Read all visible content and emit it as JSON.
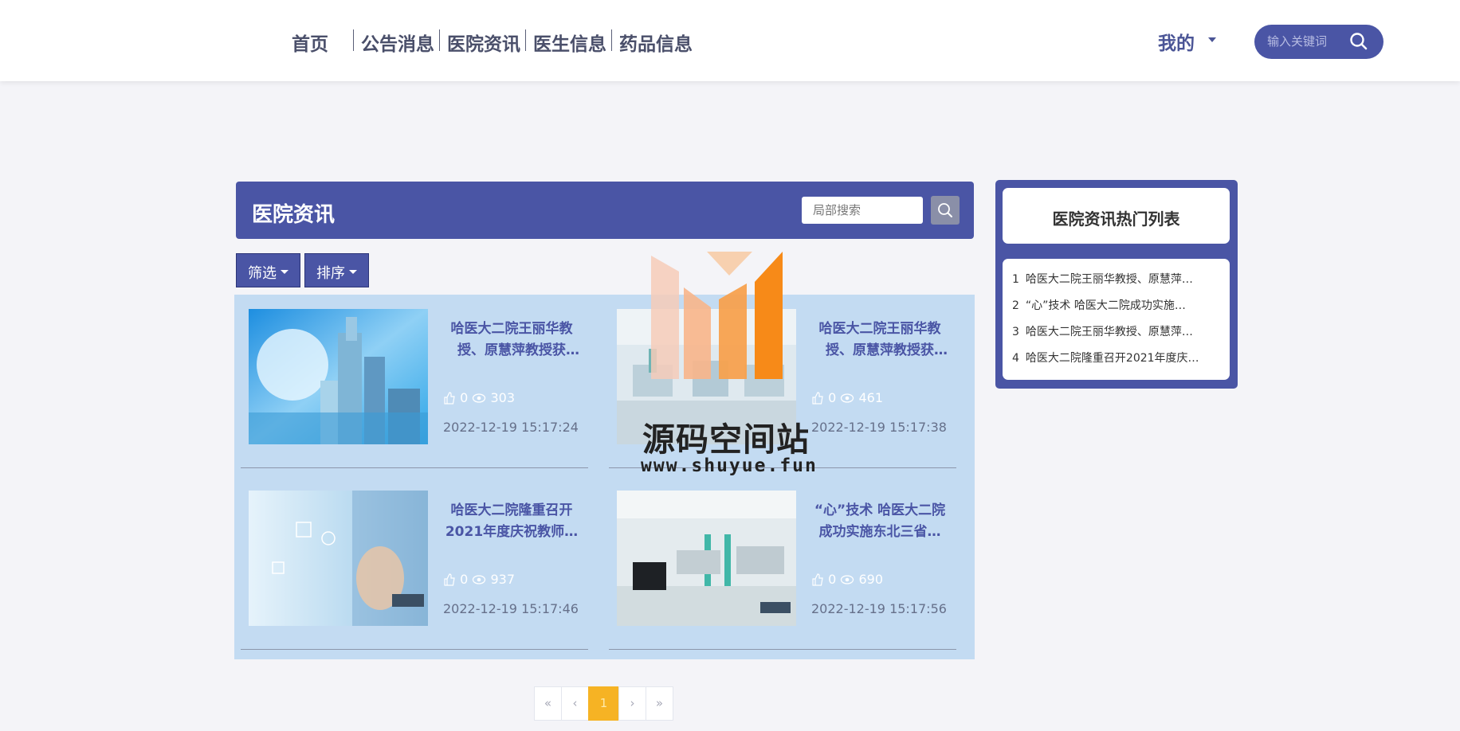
{
  "nav": {
    "items": [
      {
        "label": "首页"
      },
      {
        "label": "公告消息"
      },
      {
        "label": "医院资讯"
      },
      {
        "label": "医生信息"
      },
      {
        "label": "药品信息"
      }
    ],
    "my_label": "我的",
    "search_placeholder": "输入关键词"
  },
  "main": {
    "title": "医院资讯",
    "local_search_placeholder": "局部搜索",
    "filter_label": "筛选",
    "sort_label": "排序",
    "articles": [
      {
        "title": "哈医大二院王丽华教授、原慧萍教授获得…",
        "likes": "0",
        "views": "303",
        "date": "2022-12-19 15:17:24",
        "thumb": "building"
      },
      {
        "title": "哈医大二院王丽华教授、原慧萍教授获得…",
        "likes": "0",
        "views": "461",
        "date": "2022-12-19 15:17:38",
        "thumb": "ward"
      },
      {
        "title": "哈医大二院隆重召开2021年度庆祝教师…",
        "likes": "0",
        "views": "937",
        "date": "2022-12-19 15:17:46",
        "thumb": "doctor"
      },
      {
        "title": "“心”技术 哈医大二院成功实施东北三省…",
        "likes": "0",
        "views": "690",
        "date": "2022-12-19 15:17:56",
        "thumb": "icu"
      }
    ]
  },
  "pagination": {
    "first": "«",
    "prev": "‹",
    "current": "1",
    "next": "›",
    "last": "»"
  },
  "sidebar": {
    "title": "医院资讯热门列表",
    "items": [
      {
        "index": "1",
        "text": "哈医大二院王丽华教授、原慧萍…"
      },
      {
        "index": "2",
        "text": "“心”技术 哈医大二院成功实施…"
      },
      {
        "index": "3",
        "text": "哈医大二院王丽华教授、原慧萍…"
      },
      {
        "index": "4",
        "text": "哈医大二院隆重召开2021年度庆…"
      }
    ]
  },
  "watermark": {
    "text": "源码空间站",
    "url": "www.shuyue.fun"
  },
  "colors": {
    "brand": "#4a55a5",
    "active_page": "#f6b324",
    "grid_bg": "#c3dbf2"
  }
}
